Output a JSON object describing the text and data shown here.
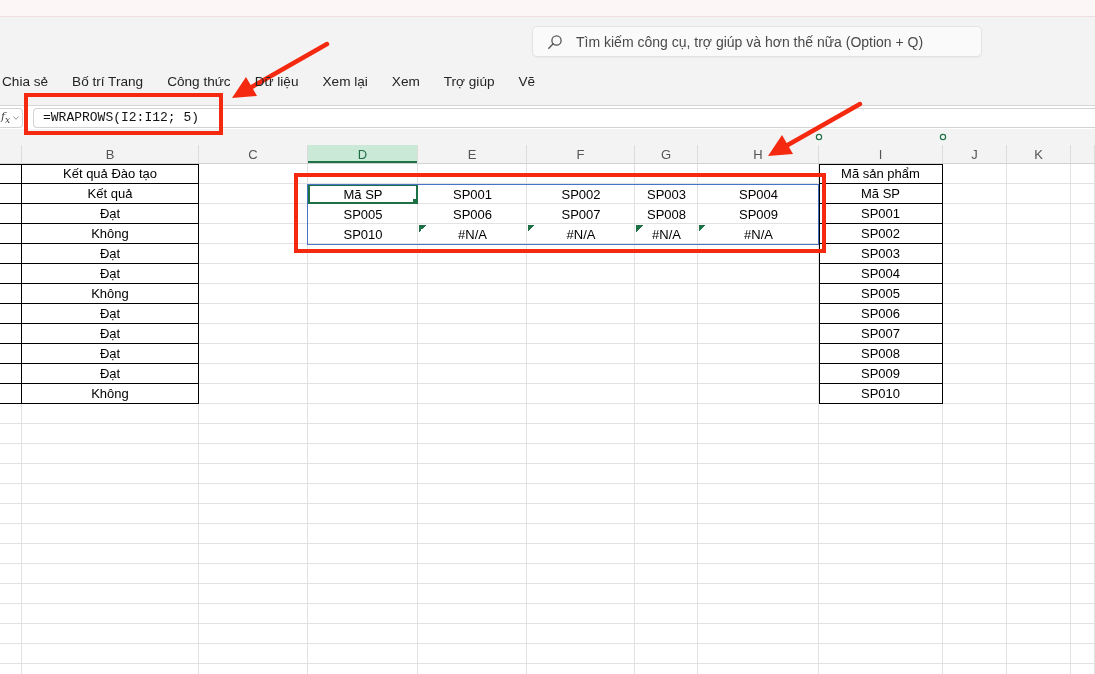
{
  "search": {
    "placeholder": "Tìm kiếm công cụ, trợ giúp và hơn thế nữa (Option + Q)"
  },
  "menu": [
    "Chia sẻ",
    "Bố trí Trang",
    "Công thức",
    "Dữ liệu",
    "Xem lại",
    "Xem",
    "Trợ giúp",
    "Vẽ"
  ],
  "formula_bar": {
    "function_label": "f$_{x}$",
    "formula": "=WRAPROWS(I2:I12; 5)"
  },
  "sheet": {
    "column_headers": [
      {
        "label": "B",
        "selected": false
      },
      {
        "label": "C",
        "selected": false
      },
      {
        "label": "D",
        "selected": true
      },
      {
        "label": "E",
        "selected": false
      },
      {
        "label": "F",
        "selected": false
      },
      {
        "label": "G",
        "selected": false
      },
      {
        "label": "H",
        "selected": false
      },
      {
        "label": "I",
        "selected": false
      },
      {
        "label": "J",
        "selected": false
      },
      {
        "label": "K",
        "selected": false
      }
    ],
    "result_column": [
      "Kết quả Đào tạo",
      "Kết quả",
      "Đạt",
      "Không",
      "Đạt",
      "Đạt",
      "Không",
      "Đạt",
      "Đạt",
      "Đạt",
      "Đạt",
      "Không"
    ],
    "spill_range": [
      [
        {
          "value": "Mã SP",
          "selected": true,
          "error": false
        },
        {
          "value": "SP001",
          "selected": false,
          "error": false
        },
        {
          "value": "SP002",
          "selected": false,
          "error": false
        },
        {
          "value": "SP003",
          "selected": false,
          "error": false
        },
        {
          "value": "SP004",
          "selected": false,
          "error": false
        }
      ],
      [
        {
          "value": "SP005",
          "selected": false,
          "error": false
        },
        {
          "value": "SP006",
          "selected": false,
          "error": false
        },
        {
          "value": "SP007",
          "selected": false,
          "error": false
        },
        {
          "value": "SP008",
          "selected": false,
          "error": false
        },
        {
          "value": "SP009",
          "selected": false,
          "error": false
        }
      ],
      [
        {
          "value": "SP010",
          "selected": false,
          "error": false
        },
        {
          "value": "#N/A",
          "selected": false,
          "error": true
        },
        {
          "value": "#N/A",
          "selected": false,
          "error": true
        },
        {
          "value": "#N/A",
          "selected": false,
          "error": true
        },
        {
          "value": "#N/A",
          "selected": false,
          "error": true
        }
      ]
    ],
    "product_column": [
      "Mã sản phẩm",
      "Mã SP",
      "SP001",
      "SP002",
      "SP003",
      "SP004",
      "SP005",
      "SP006",
      "SP007",
      "SP008",
      "SP009",
      "SP010"
    ]
  }
}
